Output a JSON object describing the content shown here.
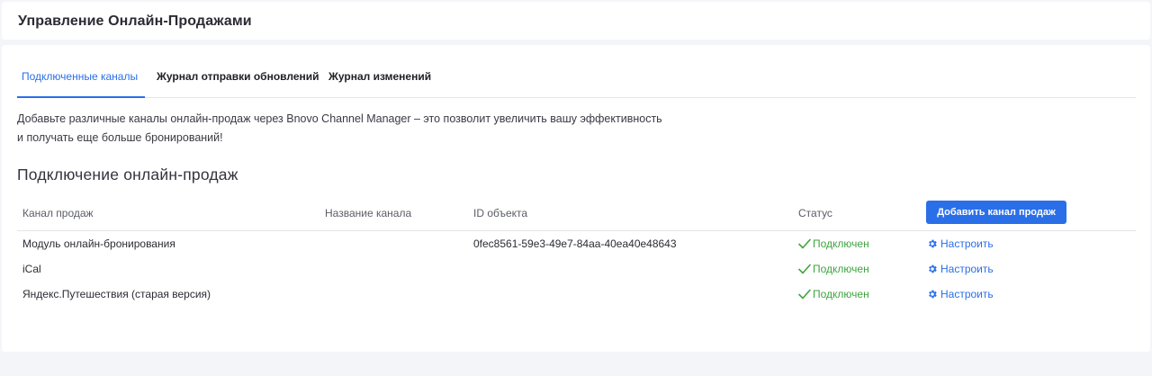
{
  "header": {
    "title": "Управление Онлайн-Продажами"
  },
  "tabs": [
    {
      "label": "Подключенные каналы",
      "active": true
    },
    {
      "label": "Журнал отправки обновлений",
      "active": false
    },
    {
      "label": "Журнал изменений",
      "active": false
    }
  ],
  "description": {
    "line1": "Добавьте различные каналы онлайн-продаж через Bnovo Channel Manager – это позволит увеличить вашу эффективность",
    "line2": "и получать еще больше бронирований!"
  },
  "section_title": "Подключение онлайн-продаж",
  "table": {
    "columns": {
      "channel": "Канал продаж",
      "channel_name": "Название канала",
      "object_id": "ID объекта",
      "status": "Статус"
    },
    "add_button_label": "Добавить канал продаж",
    "rows": [
      {
        "channel": "Модуль онлайн-бронирования",
        "channel_name": "",
        "object_id": "0fec8561-59e3-49e7-84aa-40ea40e48643",
        "status": "Подключен",
        "action": "Настроить"
      },
      {
        "channel": "iCal",
        "channel_name": "",
        "object_id": "",
        "status": "Подключен",
        "action": "Настроить"
      },
      {
        "channel": "Яндекс.Путешествия (старая версия)",
        "channel_name": "",
        "object_id": "",
        "status": "Подключен",
        "action": "Настроить"
      }
    ]
  },
  "colors": {
    "accent": "#2a6fe8",
    "status_ok": "#3ea43e",
    "background": "#f4f5f9"
  },
  "icons": {
    "status": "check-icon",
    "action": "gear-icon"
  }
}
